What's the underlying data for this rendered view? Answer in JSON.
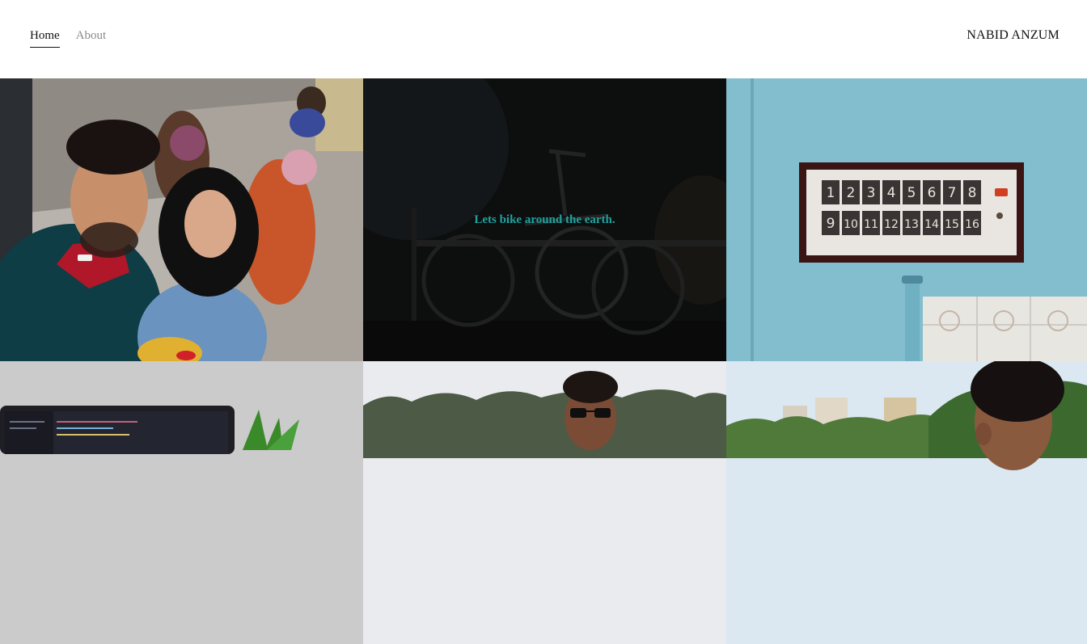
{
  "nav": {
    "home_label": "Home",
    "about_label": "About"
  },
  "brand": {
    "name": "NABID ANZUM"
  },
  "gallery": {
    "tiles": [
      {
        "type": "photo",
        "subject": "selfie-couple"
      },
      {
        "type": "photo",
        "subject": "bicycle",
        "caption": "Lets bike around the earth."
      },
      {
        "type": "photo",
        "subject": "number-panel"
      },
      {
        "type": "photo",
        "subject": "laptop-code"
      },
      {
        "type": "photo",
        "subject": "portrait-sunglasses"
      },
      {
        "type": "photo",
        "subject": "portrait-city"
      }
    ]
  },
  "panel_numbers": [
    "1",
    "2",
    "3",
    "4",
    "5",
    "6",
    "7",
    "8",
    "9",
    "10",
    "11",
    "12",
    "13",
    "14",
    "15",
    "16"
  ],
  "colors": {
    "accent_caption": "#1fa3a0",
    "nav_active": "#111111",
    "nav_inactive": "#8a8a8a"
  }
}
